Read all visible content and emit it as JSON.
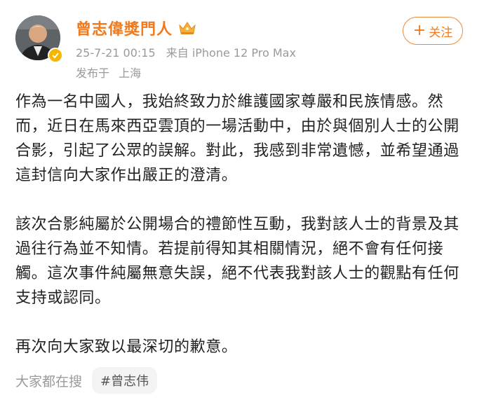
{
  "post": {
    "username": "曾志偉獎門人",
    "timestamp": "25-7-21 00:15",
    "source": "来自 iPhone 12 Pro Max",
    "location_prefix": "发布于",
    "location": "上海",
    "follow_label": "关注",
    "icons": {
      "avatar": "avatar",
      "verified": "verified-badge-icon",
      "crown": "crown-icon",
      "plus": "plus-icon"
    },
    "paragraphs": [
      "作為一名中國人，我始終致力於維護國家尊嚴和民族情感。然而，近日在馬來西亞雲頂的一場活動中，由於與個別人士的公開合影，引起了公眾的誤解。對此，我感到非常遺憾，並希望通過這封信向大家作出嚴正的澄清。",
      "該次合影純屬於公開場合的禮節性互動，我對該人士的背景及其過往行為並不知情。若提前得知其相關情況，絕不會有任何接觸。這次事件純屬無意失誤，絕不代表我對該人士的觀點有任何支持或認同。",
      "再次向大家致以最深切的歉意。"
    ]
  },
  "search": {
    "label": "大家都在搜",
    "tag": "#曾志伟"
  },
  "colors": {
    "accent": "#f07a1d",
    "meta_gray": "#9a9a9a",
    "verified": "#f6b500"
  }
}
